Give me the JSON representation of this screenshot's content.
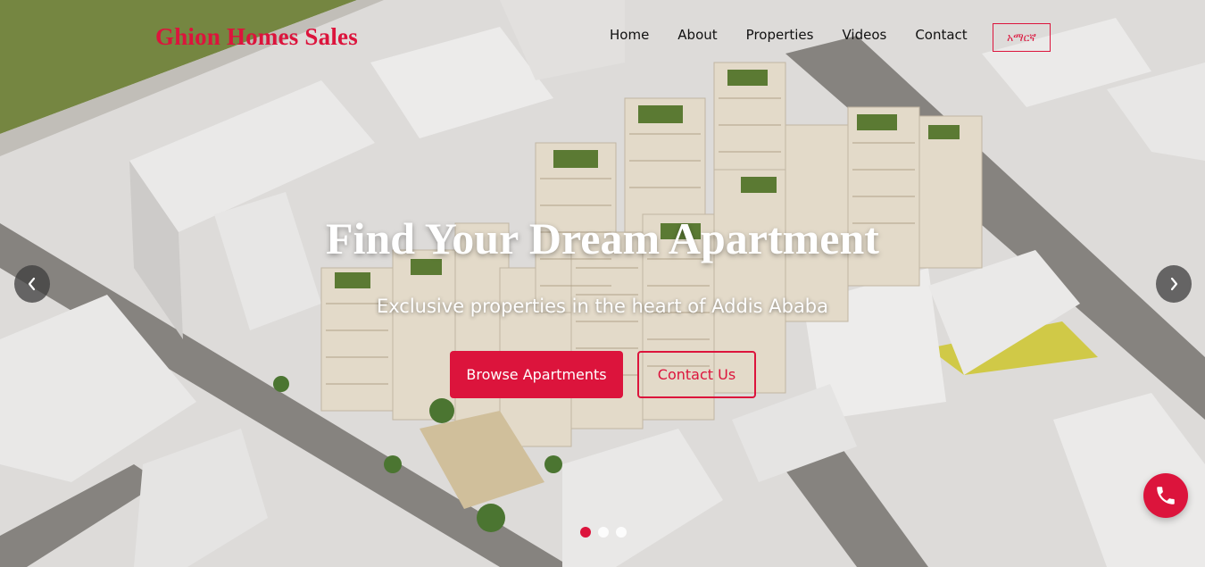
{
  "brand": {
    "name": "Ghion Homes Sales"
  },
  "nav": {
    "items": [
      {
        "label": "Home"
      },
      {
        "label": "About"
      },
      {
        "label": "Properties"
      },
      {
        "label": "Videos"
      },
      {
        "label": "Contact"
      }
    ],
    "language_button": "አማርኛ"
  },
  "hero": {
    "title": "Find Your Dream Apartment",
    "subtitle": "Exclusive properties in the heart of Addis Ababa",
    "primary_button": "Browse Apartments",
    "secondary_button": "Contact Us"
  },
  "carousel": {
    "slide_count": 3,
    "active_slide": 1,
    "prev_icon": "chevron-left-icon",
    "next_icon": "chevron-right-icon"
  },
  "floating": {
    "call_icon": "phone-icon"
  },
  "colors": {
    "accent": "#dc143c",
    "nav_text": "#111111",
    "hero_text": "#ffffff"
  }
}
